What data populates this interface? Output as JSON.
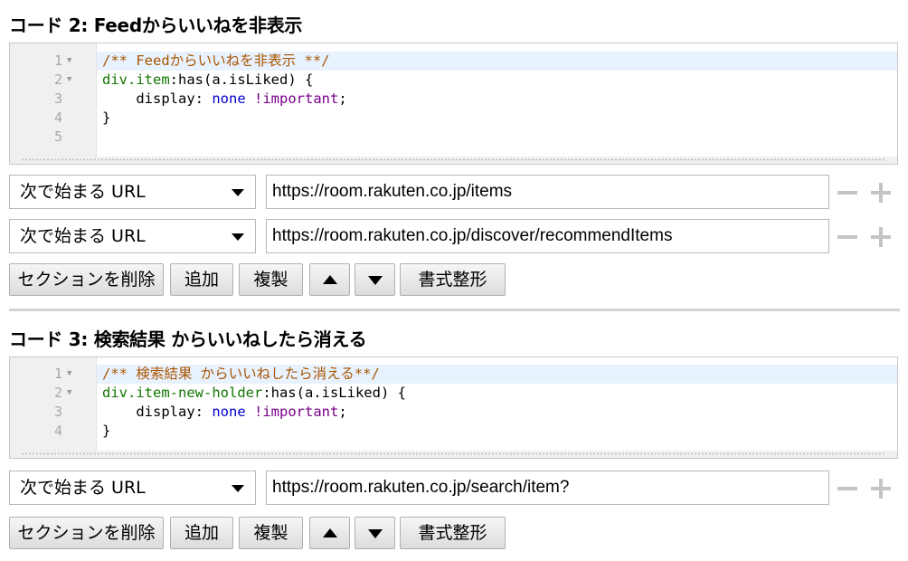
{
  "sections": [
    {
      "title": "コード 2: Feedからいいねを非表示",
      "line_numbers": [
        "1",
        "2",
        "3",
        "4",
        "5"
      ],
      "code": {
        "l1_comment": "/** Feedからいいねを非表示 **/",
        "l2_sel1": "div",
        "l2_sel2": ".item",
        "l2_rest": ":has(a.isLiked) {",
        "l3_prop": "    display: ",
        "l3_val": "none",
        "l3_space": " ",
        "l3_imp": "!important",
        "l3_semi": ";",
        "l4": "}"
      },
      "rules": [
        {
          "match": "次で始まる URL",
          "url": "https://room.rakuten.co.jp/items"
        },
        {
          "match": "次で始まる URL",
          "url": "https://room.rakuten.co.jp/discover/recommendItems"
        }
      ]
    },
    {
      "title": "コード 3: 検索結果 からいいねしたら消える",
      "line_numbers": [
        "1",
        "2",
        "3",
        "4"
      ],
      "code": {
        "l1_comment": "/** 検索結果 からいいねしたら消える**/",
        "l2_sel1": "div",
        "l2_sel2": ".item-new-holder",
        "l2_rest": ":has(a.isLiked) {",
        "l3_prop": "    display: ",
        "l3_val": "none",
        "l3_space": " ",
        "l3_imp": "!important",
        "l3_semi": ";",
        "l4": "}"
      },
      "rules": [
        {
          "match": "次で始まる URL",
          "url": "https://room.rakuten.co.jp/search/item?"
        }
      ]
    }
  ],
  "buttons": {
    "delete_section": "セクションを削除",
    "add": "追加",
    "duplicate": "複製",
    "format": "書式整形"
  },
  "colors": {
    "comment": "#aa5500",
    "selector": "#117700",
    "keyword": "#0000cc",
    "important": "#770088",
    "active_line": "#e8f2fe"
  },
  "icons": [
    "fold-arrow-icon",
    "dropdown-arrow-icon",
    "minus-icon",
    "plus-icon",
    "move-up-icon",
    "move-down-icon"
  ]
}
